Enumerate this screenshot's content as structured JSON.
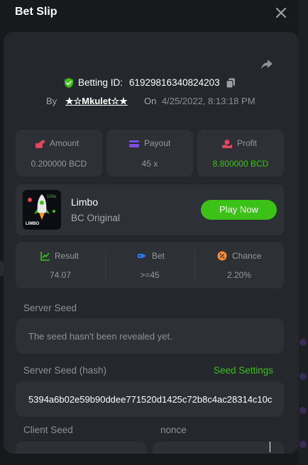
{
  "header": {
    "title": "Bet Slip"
  },
  "bet": {
    "id_label": "Betting ID:",
    "id": "61929816340824203",
    "by_label": "By",
    "user": "★☆Mkulet☆★",
    "on_label": "On",
    "date": "4/25/2022, 8:13:18 PM"
  },
  "stats": {
    "amount": {
      "label": "Amount",
      "value": "0.200000 BCD"
    },
    "payout": {
      "label": "Payout",
      "value": "45 x"
    },
    "profit": {
      "label": "Profit",
      "value": "8.800000 BCD"
    }
  },
  "game": {
    "name": "Limbo",
    "subtitle": "BC Original",
    "thumb_text": "LIMBO",
    "thumb_badge": "100x",
    "play_label": "Play Now"
  },
  "result": {
    "result": {
      "label": "Result",
      "value": "74.07"
    },
    "bet": {
      "label": "Bet",
      "value": ">=45"
    },
    "chance": {
      "label": "Chance",
      "value": "2.20%"
    }
  },
  "seeds": {
    "server_label": "Server Seed",
    "server_value": "The seed hasn't been revealed yet.",
    "hash_label": "Server Seed (hash)",
    "seed_settings": "Seed Settings",
    "hash_value": "5394a6b02e59b90ddee771520d1425c72b8c4ac28314c10c",
    "client_label": "Client Seed",
    "nonce_label": "nonce"
  },
  "colors": {
    "accent_green": "#3bc117",
    "card": "#24272b",
    "panel": "#2d3035"
  }
}
